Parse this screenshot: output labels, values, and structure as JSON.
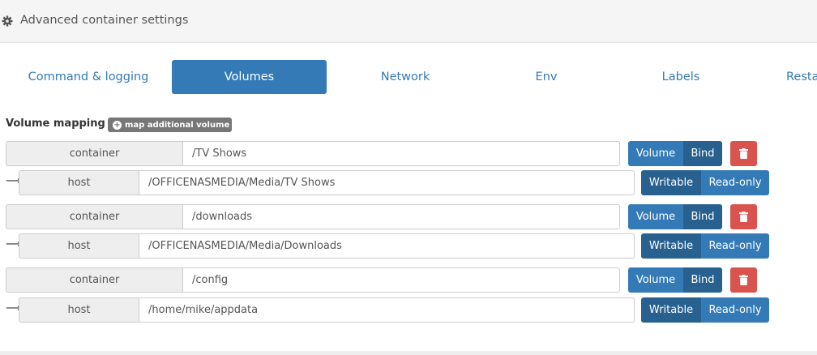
{
  "header": {
    "title": "Advanced container settings",
    "icon": "gear-icon"
  },
  "tabs": [
    {
      "label": "Command & logging",
      "active": false
    },
    {
      "label": "Volumes",
      "active": true
    },
    {
      "label": "Network",
      "active": false
    },
    {
      "label": "Env",
      "active": false
    },
    {
      "label": "Labels",
      "active": false
    },
    {
      "label": "Resta",
      "active": false
    }
  ],
  "volumes": {
    "section_label": "Volume mapping",
    "add_label": "map additional volume",
    "container_label": "container",
    "host_label": "host",
    "type_options": [
      "Volume",
      "Bind"
    ],
    "mode_options": [
      "Writable",
      "Read-only"
    ],
    "mappings": [
      {
        "container": "/TV Shows",
        "host": "/OFFICENASMEDIA/Media/TV Shows",
        "type": "Bind",
        "mode": "Writable"
      },
      {
        "container": "/downloads",
        "host": "/OFFICENASMEDIA/Media/Downloads",
        "type": "Bind",
        "mode": "Writable"
      },
      {
        "container": "/config",
        "host": "/home/mike/appdata",
        "type": "Bind",
        "mode": "Writable"
      }
    ]
  },
  "colors": {
    "primary": "#337ab7",
    "primary_active": "#286090",
    "danger": "#d9534f",
    "header_bg": "#f5f5f5"
  }
}
